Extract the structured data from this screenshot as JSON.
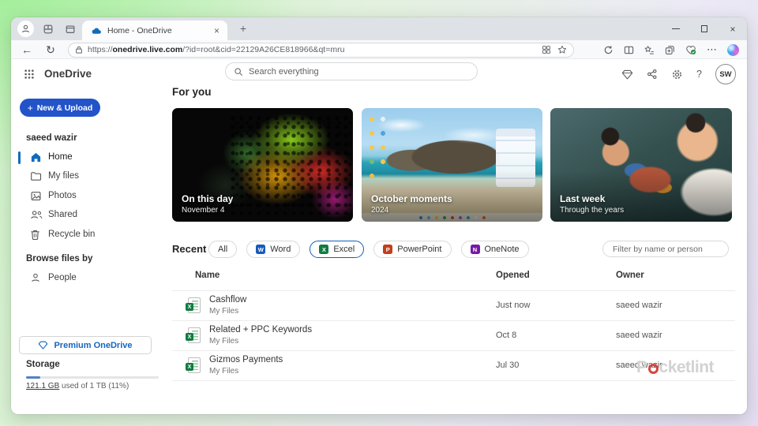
{
  "browser": {
    "tab_title": "Home - OneDrive",
    "url_scheme": "https://",
    "url_domain": "onedrive.live.com",
    "url_path": "/?id=root&cid=22129A26CE818966&qt=mru",
    "glyphs": {
      "back": "←",
      "refresh": "↻",
      "new_tab": "+",
      "close_tab": "×",
      "more": "⋯",
      "close_window": "×"
    }
  },
  "header": {
    "app_name": "OneDrive",
    "search_placeholder": "Search everything",
    "help_glyph": "?",
    "avatar_initials": "SW"
  },
  "sidebar": {
    "new_upload_plus": "+",
    "new_upload_label": "New & Upload",
    "owner_name": "saeed wazir",
    "items": [
      {
        "label": "Home"
      },
      {
        "label": "My files"
      },
      {
        "label": "Photos"
      },
      {
        "label": "Shared"
      },
      {
        "label": "Recycle bin"
      }
    ],
    "browse_heading": "Browse files by",
    "browse_items": [
      {
        "label": "People"
      }
    ],
    "premium_label": "Premium OneDrive",
    "storage_heading": "Storage",
    "storage_used_link": "121.1 GB",
    "storage_rest": " used of 1 TB (11%)",
    "storage_percent": 11
  },
  "foryou": {
    "heading": "For you",
    "cards": [
      {
        "title": "On this day",
        "subtitle": "November 4"
      },
      {
        "title": "October moments",
        "subtitle": "2024"
      },
      {
        "title": "Last week",
        "subtitle": "Through the years"
      }
    ]
  },
  "recent": {
    "heading": "Recent",
    "filter_placeholder": "Filter by name or person",
    "filters": [
      {
        "label": "All"
      },
      {
        "label": "Word",
        "letter": "W",
        "color": "#185abd"
      },
      {
        "label": "Excel",
        "letter": "X",
        "color": "#107c41",
        "selected": true
      },
      {
        "label": "PowerPoint",
        "letter": "P",
        "color": "#c43e1c"
      },
      {
        "label": "OneNote",
        "letter": "N",
        "color": "#7719aa"
      }
    ],
    "table": {
      "columns": [
        "Name",
        "Opened",
        "Owner"
      ],
      "rows": [
        {
          "name": "Cashflow",
          "location": "My Files",
          "opened": "Just now",
          "owner": "saeed wazir"
        },
        {
          "name": "Related + PPC Keywords",
          "location": "My Files",
          "opened": "Oct 8",
          "owner": "saeed wazir"
        },
        {
          "name": "Gizmos Payments",
          "location": "My Files",
          "opened": "Jul 30",
          "owner": "saeed wazir"
        }
      ]
    }
  },
  "icons": {
    "excel_letter": "X"
  },
  "watermark": {
    "prefix": "P",
    "suffix": "cketlint"
  }
}
